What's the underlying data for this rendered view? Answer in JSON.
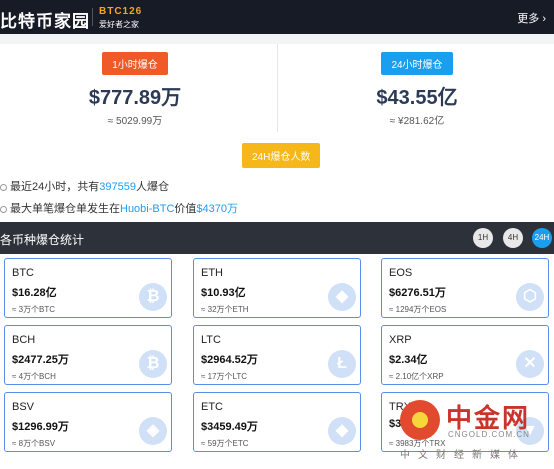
{
  "header": {
    "site_name": "比特币家园",
    "brand": "BTC126",
    "slogan": "爱好者之家",
    "more": "更多"
  },
  "stats": {
    "hour": {
      "badge": "1小时爆仓",
      "amount": "$777.89万",
      "approx": "≈ 5029.99万"
    },
    "day": {
      "badge": "24小时爆仓",
      "amount": "$43.55亿",
      "approx": "≈ ¥281.62亿"
    }
  },
  "info": {
    "badge": "24H爆仓人数",
    "line1": {
      "prefix": "最近24小时，共有",
      "count": "397559",
      "suffix": "人爆仓"
    },
    "line2": {
      "prefix": "最大单笔爆仓单发生在",
      "exchange": "Huobi-BTC",
      "mid": "价值",
      "value": "$4370万"
    }
  },
  "section": {
    "title": "各币种爆仓统计",
    "timeframes": [
      "1H",
      "4H",
      "24H"
    ],
    "active": "24H"
  },
  "coins": [
    {
      "symbol": "BTC",
      "value": "$16.28亿",
      "sub": "≈ 3万个BTC",
      "icon": "bitcoin-icon",
      "glyph": "₿"
    },
    {
      "symbol": "ETH",
      "value": "$10.93亿",
      "sub": "≈ 32万个ETH",
      "icon": "ethereum-icon",
      "glyph": "◆"
    },
    {
      "symbol": "EOS",
      "value": "$6276.51万",
      "sub": "≈ 1294万个EOS",
      "icon": "eos-icon",
      "glyph": "⬡"
    },
    {
      "symbol": "BCH",
      "value": "$2477.25万",
      "sub": "≈ 4万个BCH",
      "icon": "bitcoin-cash-icon",
      "glyph": "₿"
    },
    {
      "symbol": "LTC",
      "value": "$2964.52万",
      "sub": "≈ 17万个LTC",
      "icon": "litecoin-icon",
      "glyph": "Ł"
    },
    {
      "symbol": "XRP",
      "value": "$2.34亿",
      "sub": "≈ 2.10亿个XRP",
      "icon": "xrp-icon",
      "glyph": "✕"
    },
    {
      "symbol": "BSV",
      "value": "$1296.99万",
      "sub": "≈ 8万个BSV",
      "icon": "bsv-icon",
      "glyph": "◈"
    },
    {
      "symbol": "ETC",
      "value": "$3459.49万",
      "sub": "≈ 59万个ETC",
      "icon": "etc-icon",
      "glyph": "◆"
    },
    {
      "symbol": "TRX",
      "value": "$3",
      "sub": "≈ 3983万个TRX",
      "icon": "tron-icon",
      "glyph": "▼"
    }
  ],
  "watermark": {
    "name": "中金网",
    "url": "CNGOLD.COM.CN",
    "slogan": "中文财经新媒体"
  }
}
